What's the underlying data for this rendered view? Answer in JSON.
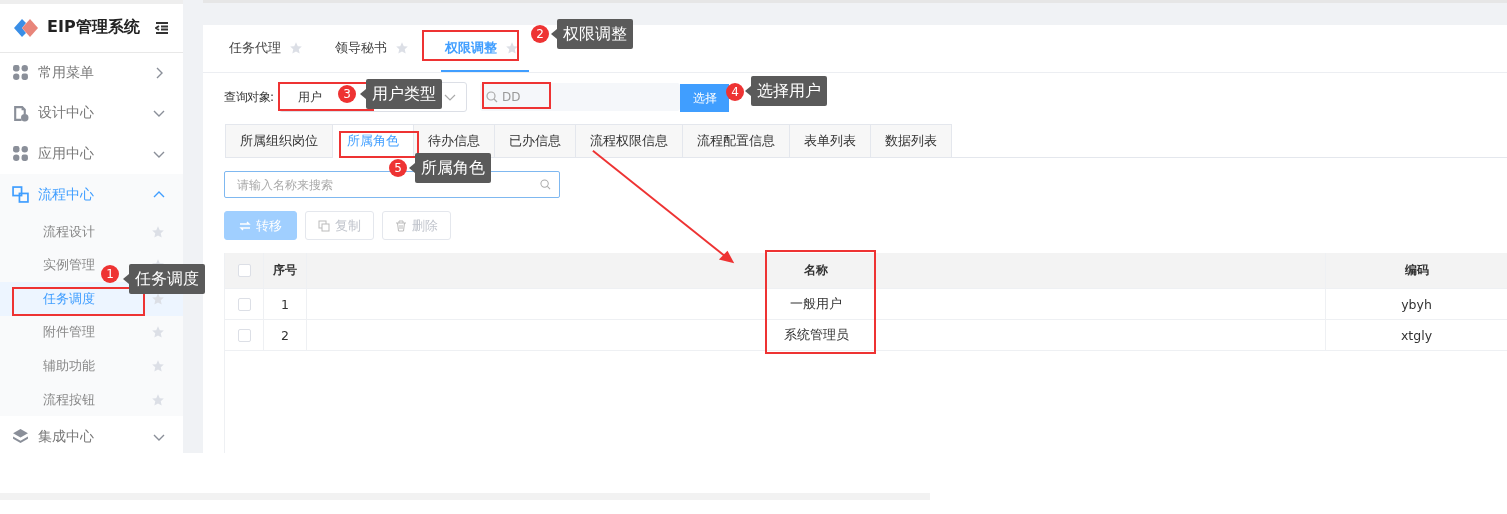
{
  "sidebar": {
    "title": "EIP管理系统",
    "items": [
      {
        "label": "常用菜单",
        "kind": "popout",
        "expanded": false
      },
      {
        "label": "设计中心",
        "kind": "group",
        "expanded": false
      },
      {
        "label": "应用中心",
        "kind": "group",
        "expanded": false
      },
      {
        "label": "流程中心",
        "kind": "group",
        "expanded": true,
        "children": [
          {
            "label": "流程设计",
            "selected": false
          },
          {
            "label": "实例管理",
            "selected": false
          },
          {
            "label": "任务调度",
            "selected": true
          },
          {
            "label": "附件管理",
            "selected": false
          },
          {
            "label": "辅助功能",
            "selected": false
          },
          {
            "label": "流程按钮",
            "selected": false
          }
        ]
      },
      {
        "label": "集成中心",
        "kind": "group",
        "expanded": false
      }
    ]
  },
  "page_tabs": [
    {
      "label": "任务代理",
      "selected": false
    },
    {
      "label": "领导秘书",
      "selected": false
    },
    {
      "label": "权限调整",
      "selected": true
    }
  ],
  "query": {
    "label": "查询对象:",
    "type_value": "用户",
    "user_placeholder": "DD",
    "choose_button": "选择"
  },
  "info_tabs": [
    {
      "label": "所属组织岗位",
      "selected": false
    },
    {
      "label": "所属角色",
      "selected": true
    },
    {
      "label": "待办信息",
      "selected": false
    },
    {
      "label": "已办信息",
      "selected": false
    },
    {
      "label": "流程权限信息",
      "selected": false
    },
    {
      "label": "流程配置信息",
      "selected": false
    },
    {
      "label": "表单列表",
      "selected": false
    },
    {
      "label": "数据列表",
      "selected": false
    }
  ],
  "search": {
    "placeholder": "请输入名称来搜索"
  },
  "actions": [
    {
      "label": "转移",
      "kind": "primary",
      "disabled": true
    },
    {
      "label": "复制",
      "kind": "copy",
      "disabled": true
    },
    {
      "label": "删除",
      "kind": "delete",
      "disabled": true
    }
  ],
  "table": {
    "all_checked": false,
    "columns": [
      "序号",
      "名称",
      "编码"
    ],
    "rows": [
      {
        "checked": false,
        "cells": [
          "1",
          "一般用户",
          "ybyh"
        ]
      },
      {
        "checked": false,
        "cells": [
          "2",
          "系统管理员",
          "xtgly"
        ]
      }
    ]
  },
  "annotations": [
    {
      "number": "1",
      "label": "任务调度"
    },
    {
      "number": "2",
      "label": "权限调整"
    },
    {
      "number": "3",
      "label": "用户类型"
    },
    {
      "number": "4",
      "label": "选择用户"
    },
    {
      "number": "5",
      "label": "所属角色"
    }
  ]
}
